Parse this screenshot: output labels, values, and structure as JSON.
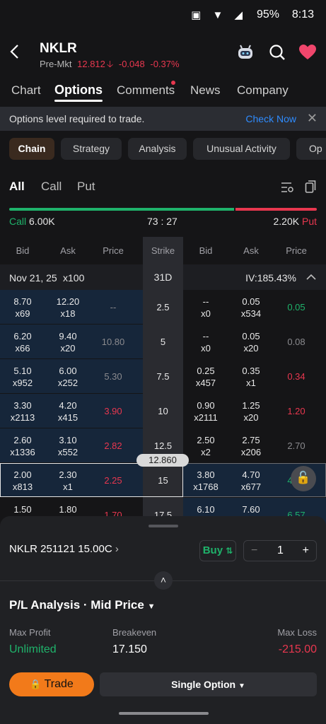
{
  "status": {
    "battery": "95%",
    "time": "8:13"
  },
  "header": {
    "ticker": "NKLR",
    "session": "Pre-Mkt",
    "price": "12.812",
    "change": "-0.048",
    "change_pct": "-0.37%"
  },
  "tabs": [
    {
      "label": "Chart"
    },
    {
      "label": "Options"
    },
    {
      "label": "Comments"
    },
    {
      "label": "News"
    },
    {
      "label": "Company"
    }
  ],
  "banner": {
    "text": "Options level required to trade.",
    "action": "Check Now"
  },
  "subtabs": [
    {
      "label": "Chain"
    },
    {
      "label": "Strategy"
    },
    {
      "label": "Analysis"
    },
    {
      "label": "Unusual Activity"
    },
    {
      "label": "Op"
    }
  ],
  "filters": {
    "all": "All",
    "call": "Call",
    "put": "Put"
  },
  "ratio": {
    "call_label": "Call",
    "call_value": "6.00K",
    "ratio": "73 : 27",
    "put_value": "2.20K",
    "put_label": "Put",
    "call_fraction": 0.73
  },
  "columns": {
    "bid": "Bid",
    "ask": "Ask",
    "price": "Price",
    "strike": "Strike"
  },
  "expiry": {
    "date": "Nov 21, 25",
    "mult": "x100",
    "days": "31D",
    "iv": "IV:185.43%"
  },
  "rows": [
    {
      "cb": "8.70",
      "cbs": "x69",
      "ca": "12.20",
      "cas": "x18",
      "cp": "--",
      "k": "2.5",
      "pb": "--",
      "pbs": "x0",
      "pa": "0.05",
      "pas": "x534",
      "pp": "0.05"
    },
    {
      "cb": "6.20",
      "cbs": "x66",
      "ca": "9.40",
      "cas": "x20",
      "cp": "10.80",
      "k": "5",
      "pb": "--",
      "pbs": "x0",
      "pa": "0.05",
      "pas": "x20",
      "pp": "0.08"
    },
    {
      "cb": "5.10",
      "cbs": "x952",
      "ca": "6.00",
      "cas": "x252",
      "cp": "5.30",
      "k": "7.5",
      "pb": "0.25",
      "pbs": "x457",
      "pa": "0.35",
      "pas": "x1",
      "pp": "0.34"
    },
    {
      "cb": "3.30",
      "cbs": "x2113",
      "ca": "4.20",
      "cas": "x415",
      "cp": "3.90",
      "k": "10",
      "pb": "0.90",
      "pbs": "x2111",
      "pa": "1.25",
      "pas": "x20",
      "pp": "1.20"
    },
    {
      "cb": "2.60",
      "cbs": "x1336",
      "ca": "3.10",
      "cas": "x552",
      "cp": "2.82",
      "k": "12.5",
      "pb": "2.50",
      "pbs": "x2",
      "pa": "2.75",
      "pas": "x206",
      "pp": "2.70"
    },
    {
      "cb": "2.00",
      "cbs": "x813",
      "ca": "2.30",
      "cas": "x1",
      "cp": "2.25",
      "k": "15",
      "pb": "3.80",
      "pbs": "x1768",
      "pa": "4.70",
      "pas": "x677",
      "pp": "4.35"
    },
    {
      "cb": "1.50",
      "cbs": "",
      "ca": "1.80",
      "cas": "",
      "cp": "1.70",
      "k": "17.5",
      "pb": "6.10",
      "pbs": "",
      "pa": "7.60",
      "pas": "",
      "pp": "6.57"
    }
  ],
  "underlying_marker": "12.860",
  "order": {
    "contract": "NKLR 251121 15.00C",
    "buy": "Buy",
    "qty": "1",
    "minus": "−",
    "plus": "+"
  },
  "pl": {
    "title": "P/L Analysis · Mid Price",
    "max_profit_label": "Max Profit",
    "max_profit": "Unlimited",
    "breakeven_label": "Breakeven",
    "breakeven": "17.150",
    "max_loss_label": "Max Loss",
    "max_loss": "-215.00"
  },
  "actions": {
    "trade": "Trade",
    "single": "Single Option"
  },
  "colors": {
    "green": "#1fb36b",
    "red": "#e8374f",
    "orange": "#f27a1a",
    "blue": "#2f8cff"
  }
}
